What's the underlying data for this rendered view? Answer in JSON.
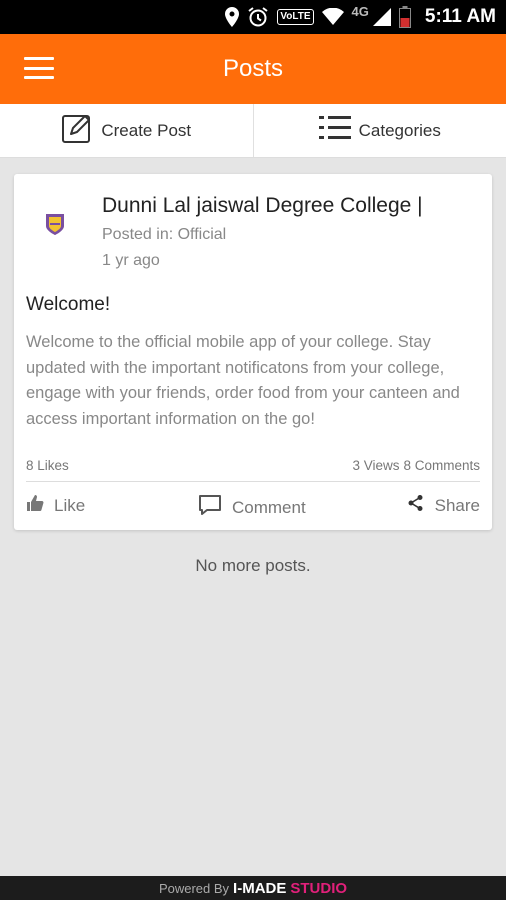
{
  "status_bar": {
    "network": "4G",
    "volte": "VoLTE",
    "time": "5:11 AM"
  },
  "app_bar": {
    "title": "Posts"
  },
  "toolbar": {
    "create_post": "Create Post",
    "categories": "Categories"
  },
  "post": {
    "author": "Dunni Lal jaiswal Degree College |",
    "posted_in": "Posted in: Official",
    "time_ago": "1 yr ago",
    "title": "Welcome!",
    "body": "Welcome to the official mobile app of your college. Stay updated with the important notificatons from your college, engage with your friends, order food from your canteen and access important information on the go!",
    "likes": "8 Likes",
    "views": "3 Views",
    "comments": "8 Comments",
    "actions": {
      "like": "Like",
      "comment": "Comment",
      "share": "Share"
    }
  },
  "feed_end": "No more posts.",
  "footer": {
    "prefix": "Powered By",
    "brand": "I-MADE",
    "brand_suffix": "STUDIO"
  },
  "colors": {
    "accent": "#ff6d0a",
    "background": "#e5e5e5",
    "brand_pink": "#e0207a"
  }
}
